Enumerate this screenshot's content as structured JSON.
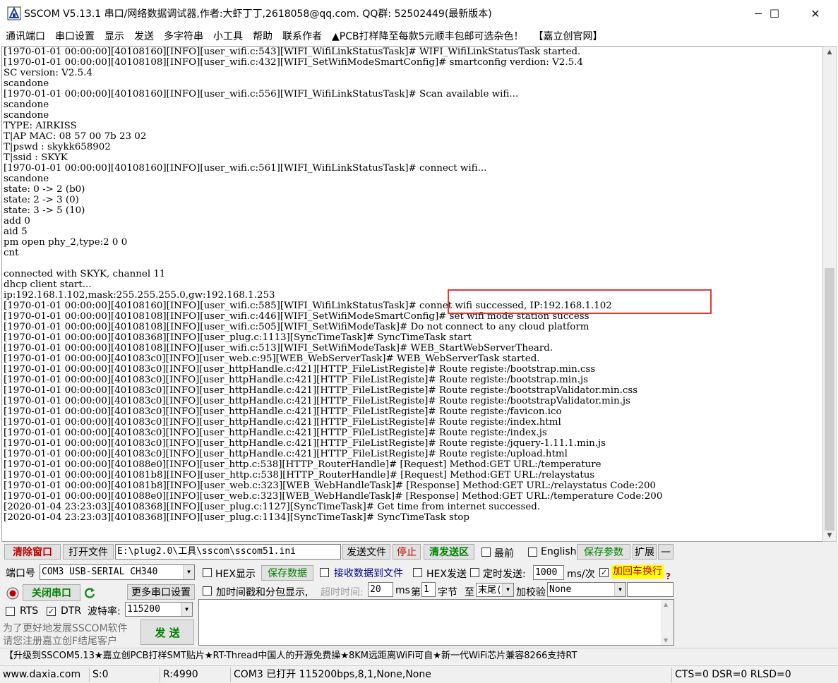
{
  "window": {
    "title": "SSCOM V5.13.1 串口/网络数据调试器,作者:大虾丁丁,2618058@qq.com. QQ群:  52502449(最新版本)",
    "minimize": "─",
    "maximize": "☐",
    "close": "✕"
  },
  "menu": [
    "通讯端口",
    "串口设置",
    "显示",
    "发送",
    "多字符串",
    "小工具",
    "帮助",
    "联系作者",
    "▲PCB打样降至每款5元顺丰包邮可选杂色！",
    "【嘉立创官网】"
  ],
  "terminal": {
    "lines": [
      "[1970-01-01 00:00:00][40108160][INFO][user_wifi.c:543][WIFI_WifiLinkStatusTask]# WIFI_WifiLinkStatusTask started.",
      "[1970-01-01 00:00:00][40108108][INFO][user_wifi.c:432][WIFI_SetWifiModeSmartConfig]# smartconfig verdion: V2.5.4",
      "SC version: V2.5.4",
      "scandone",
      "[1970-01-01 00:00:00][40108160][INFO][user_wifi.c:556][WIFI_WifiLinkStatusTask]# Scan available wifi...",
      "scandone",
      "scandone",
      "TYPE: AIRKISS",
      "T|AP MAC: 08 57 00 7b 23 02",
      "T|pswd : skykk658902",
      "T|ssid : SKYK",
      "[1970-01-01 00:00:00][40108160][INFO][user_wifi.c:561][WIFI_WifiLinkStatusTask]# connect wifi...",
      "scandone",
      "state: 0 -> 2 (b0)",
      "state: 2 -> 3 (0)",
      "state: 3 -> 5 (10)",
      "add 0",
      "aid 5",
      "pm open phy_2,type:2 0 0",
      "cnt",
      "",
      "connected with SKYK, channel 11",
      "dhcp client start...",
      "ip:192.168.1.102,mask:255.255.255.0,gw:192.168.1.253",
      "[1970-01-01 00:00:00][40108160][INFO][user_wifi.c:585][WIFI_WifiLinkStatusTask]# connet wifi successed, IP:192.168.1.102",
      "[1970-01-01 00:00:00][40108108][INFO][user_wifi.c:446][WIFI_SetWifiModeSmartConfig]# set wifi mode station success",
      "[1970-01-01 00:00:00][40108108][INFO][user_wifi.c:505][WIFI_SetWifiModeTask]# Do not connect to any cloud platform",
      "[1970-01-01 00:00:00][40108368][INFO][user_plug.c:1113][SyncTimeTask]# SyncTimeTask start",
      "[1970-01-01 00:00:00][40108108][INFO][user_wifi.c:513][WIFI_SetWifiModeTask]# WEB_StartWebServerTheard.",
      "[1970-01-01 00:00:00][401083c0][INFO][user_web.c:95][WEB_WebServerTask]# WEB_WebServerTask started.",
      "[1970-01-01 00:00:00][401083c0][INFO][user_httpHandle.c:421][HTTP_FileListRegiste]# Route registe:/bootstrap.min.css",
      "[1970-01-01 00:00:00][401083c0][INFO][user_httpHandle.c:421][HTTP_FileListRegiste]# Route registe:/bootstrap.min.js",
      "[1970-01-01 00:00:00][401083c0][INFO][user_httpHandle.c:421][HTTP_FileListRegiste]# Route registe:/bootstrapValidator.min.css",
      "[1970-01-01 00:00:00][401083c0][INFO][user_httpHandle.c:421][HTTP_FileListRegiste]# Route registe:/bootstrapValidator.min.js",
      "[1970-01-01 00:00:00][401083c0][INFO][user_httpHandle.c:421][HTTP_FileListRegiste]# Route registe:/favicon.ico",
      "[1970-01-01 00:00:00][401083c0][INFO][user_httpHandle.c:421][HTTP_FileListRegiste]# Route registe:/index.html",
      "[1970-01-01 00:00:00][401083c0][INFO][user_httpHandle.c:421][HTTP_FileListRegiste]# Route registe:/index.js",
      "[1970-01-01 00:00:00][401083c0][INFO][user_httpHandle.c:421][HTTP_FileListRegiste]# Route registe:/jquery-1.11.1.min.js",
      "[1970-01-01 00:00:00][401083c0][INFO][user_httpHandle.c:421][HTTP_FileListRegiste]# Route registe:/upload.html",
      "[1970-01-01 00:00:00][401088e0][INFO][user_http.c:538][HTTP_RouterHandle]# [Request] Method:GET URL:/temperature",
      "[1970-01-01 00:00:00][401081b8][INFO][user_http.c:538][HTTP_RouterHandle]# [Request] Method:GET URL:/relaystatus",
      "[1970-01-01 00:00:00][401081b8][INFO][user_web.c:323][WEB_WebHandleTask]# [Response] Method:GET URL:/relaystatus Code:200",
      "[1970-01-01 00:00:00][401088e0][INFO][user_web.c:323][WEB_WebHandleTask]# [Response] Method:GET URL:/temperature Code:200",
      "[2020-01-04 23:23:03][40108368][INFO][user_plug.c:1127][SyncTimeTask]# Get time from internet successed.",
      "[2020-01-04 23:23:03][40108368][INFO][user_plug.c:1134][SyncTimeTask]# SyncTimeTask stop"
    ]
  },
  "toolbar1": {
    "clear_window": "清除窗口",
    "open_file": "打开文件",
    "file_path": "E:\\plug2.0\\工具\\sscom\\sscom51.ini",
    "send_file": "发送文件",
    "stop": "停止",
    "clear_send": "清发送区",
    "topmost": "最前",
    "english": "English",
    "save_params": "保存参数",
    "expand": "扩展",
    "collapse": "—"
  },
  "port": {
    "port_label": "端口号",
    "port_value": "COM3 USB-SERIAL CH340",
    "close_port": "关闭串口",
    "more_settings": "更多串口设置",
    "rts": "RTS",
    "dtr": "DTR",
    "baud_label": "波特率:",
    "baud_value": "115200",
    "promo_line1": "为了更好地发展SSCOM软件",
    "promo_line2": "请您注册嘉立创F结尾客户",
    "send": "发  送"
  },
  "options": {
    "hex_display": "HEX显示",
    "save_data": "保存数据",
    "recv_to_file": "接收数据到文件",
    "hex_send": "HEX发送",
    "timed_send": "定时发送:",
    "interval": "1000",
    "ms_per": "ms/次",
    "add_crlf": "加回车换行",
    "help": "?",
    "timestamp": "加时间戳和分包显示,",
    "timeout_label": "超时时间:",
    "timeout_value": "20",
    "ms": "ms",
    "byte_label": "第",
    "byte_value": "1",
    "byte_unit": "字节",
    "to": "至",
    "to_value": "末尾(",
    "checksum": "加校验",
    "checksum_value": "None"
  },
  "ticker": "【升级到SSCOM5.13★嘉立创PCB打样SMT贴片★RT-Thread中国人的开源免费操★8KM远距离WiFi可自★新一代WiFi芯片兼容8266支持RT",
  "status": {
    "url": "www.daxia.com",
    "sent": "S:0",
    "received": "R:4990",
    "port_state": "COM3 已打开  115200bps,8,1,None,None",
    "lines": "CTS=0 DSR=0 RLSD=0"
  },
  "colors": {
    "highlight_box": "#e53935",
    "red_text": "#c00000",
    "green_text": "#008000",
    "yellow_bg": "#ffff00"
  }
}
